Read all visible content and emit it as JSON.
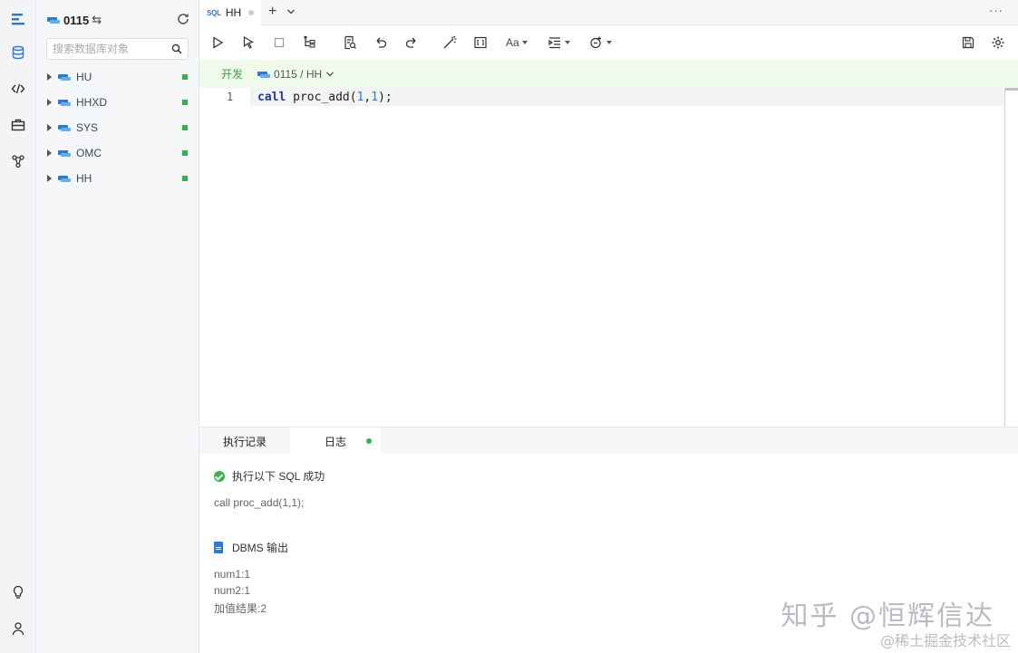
{
  "activity_bar": {
    "items": [
      "logo-icon",
      "database-icon",
      "code-icon",
      "toolbox-icon",
      "deploy-icon"
    ],
    "bottom": [
      "bulb-icon",
      "user-icon"
    ]
  },
  "sidebar": {
    "title": "0115",
    "switch_glyph": "⇆",
    "search_placeholder": "搜索数据库对象",
    "tree": [
      {
        "label": "HU",
        "status": "online"
      },
      {
        "label": "HHXD",
        "status": "online"
      },
      {
        "label": "SYS",
        "status": "online"
      },
      {
        "label": "OMC",
        "status": "online"
      },
      {
        "label": "HH",
        "status": "online"
      }
    ]
  },
  "tabs": {
    "active": {
      "badge": "SQL",
      "label": "HH"
    },
    "add_glyph": "+",
    "more_glyph": "···"
  },
  "context": {
    "env": "开发",
    "db_path": "0115 / HH"
  },
  "editor": {
    "line_number": "1",
    "code": {
      "kw": "call",
      "fn": " proc_add(",
      "a1": "1",
      "sep": ",",
      "a2": "1",
      "end": ");"
    }
  },
  "results": {
    "tabs": [
      "执行记录",
      "日志"
    ],
    "success_text": "执行以下 SQL 成功",
    "sql": "call proc_add(1,1);",
    "dbms_title": "DBMS 输出",
    "output": [
      "num1:1",
      "num2:1",
      "加值结果:2"
    ]
  },
  "watermark": {
    "main": "知乎 @恒辉信达",
    "sub": "@稀土掘金技术社区"
  },
  "colors": {
    "accent": "#2b78d8",
    "success": "#35b34a",
    "context_bg": "#f0faea",
    "env_text": "#3aa13a"
  }
}
